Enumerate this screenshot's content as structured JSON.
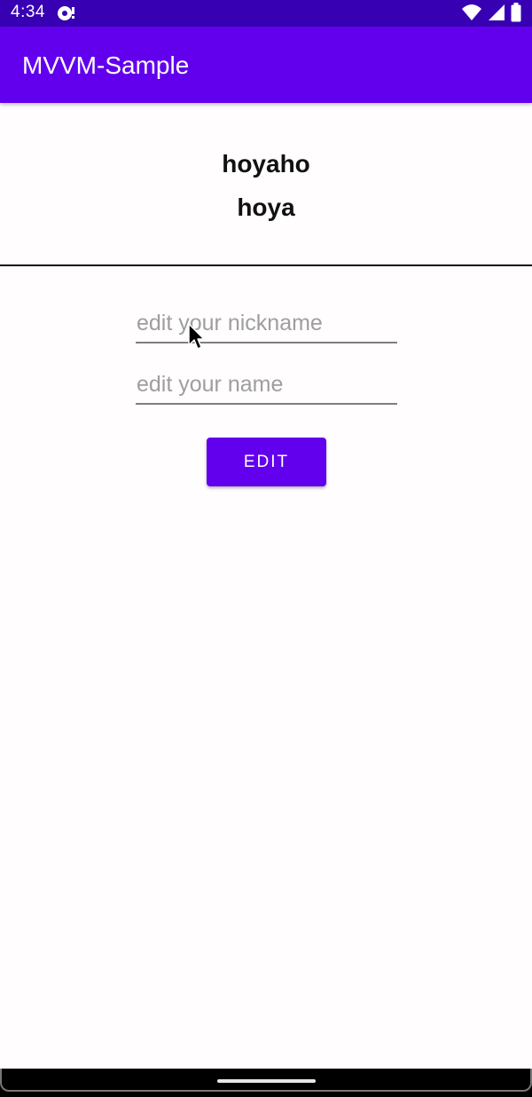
{
  "status_bar": {
    "time": "4:34",
    "notification_icon": "cast-icon",
    "icons": [
      "wifi-icon",
      "cell-signal-icon",
      "battery-icon"
    ]
  },
  "app_bar": {
    "title": "MVVM-Sample",
    "color": "#6200ee"
  },
  "profile": {
    "nickname": "hoyaho",
    "name": "hoya"
  },
  "form": {
    "nickname_placeholder": "edit your nickname",
    "nickname_value": "",
    "name_placeholder": "edit your name",
    "name_value": "",
    "edit_label": "EDIT"
  },
  "colors": {
    "status_bar": "#3700b3",
    "primary": "#6200ee",
    "background": "#fffdfe"
  }
}
